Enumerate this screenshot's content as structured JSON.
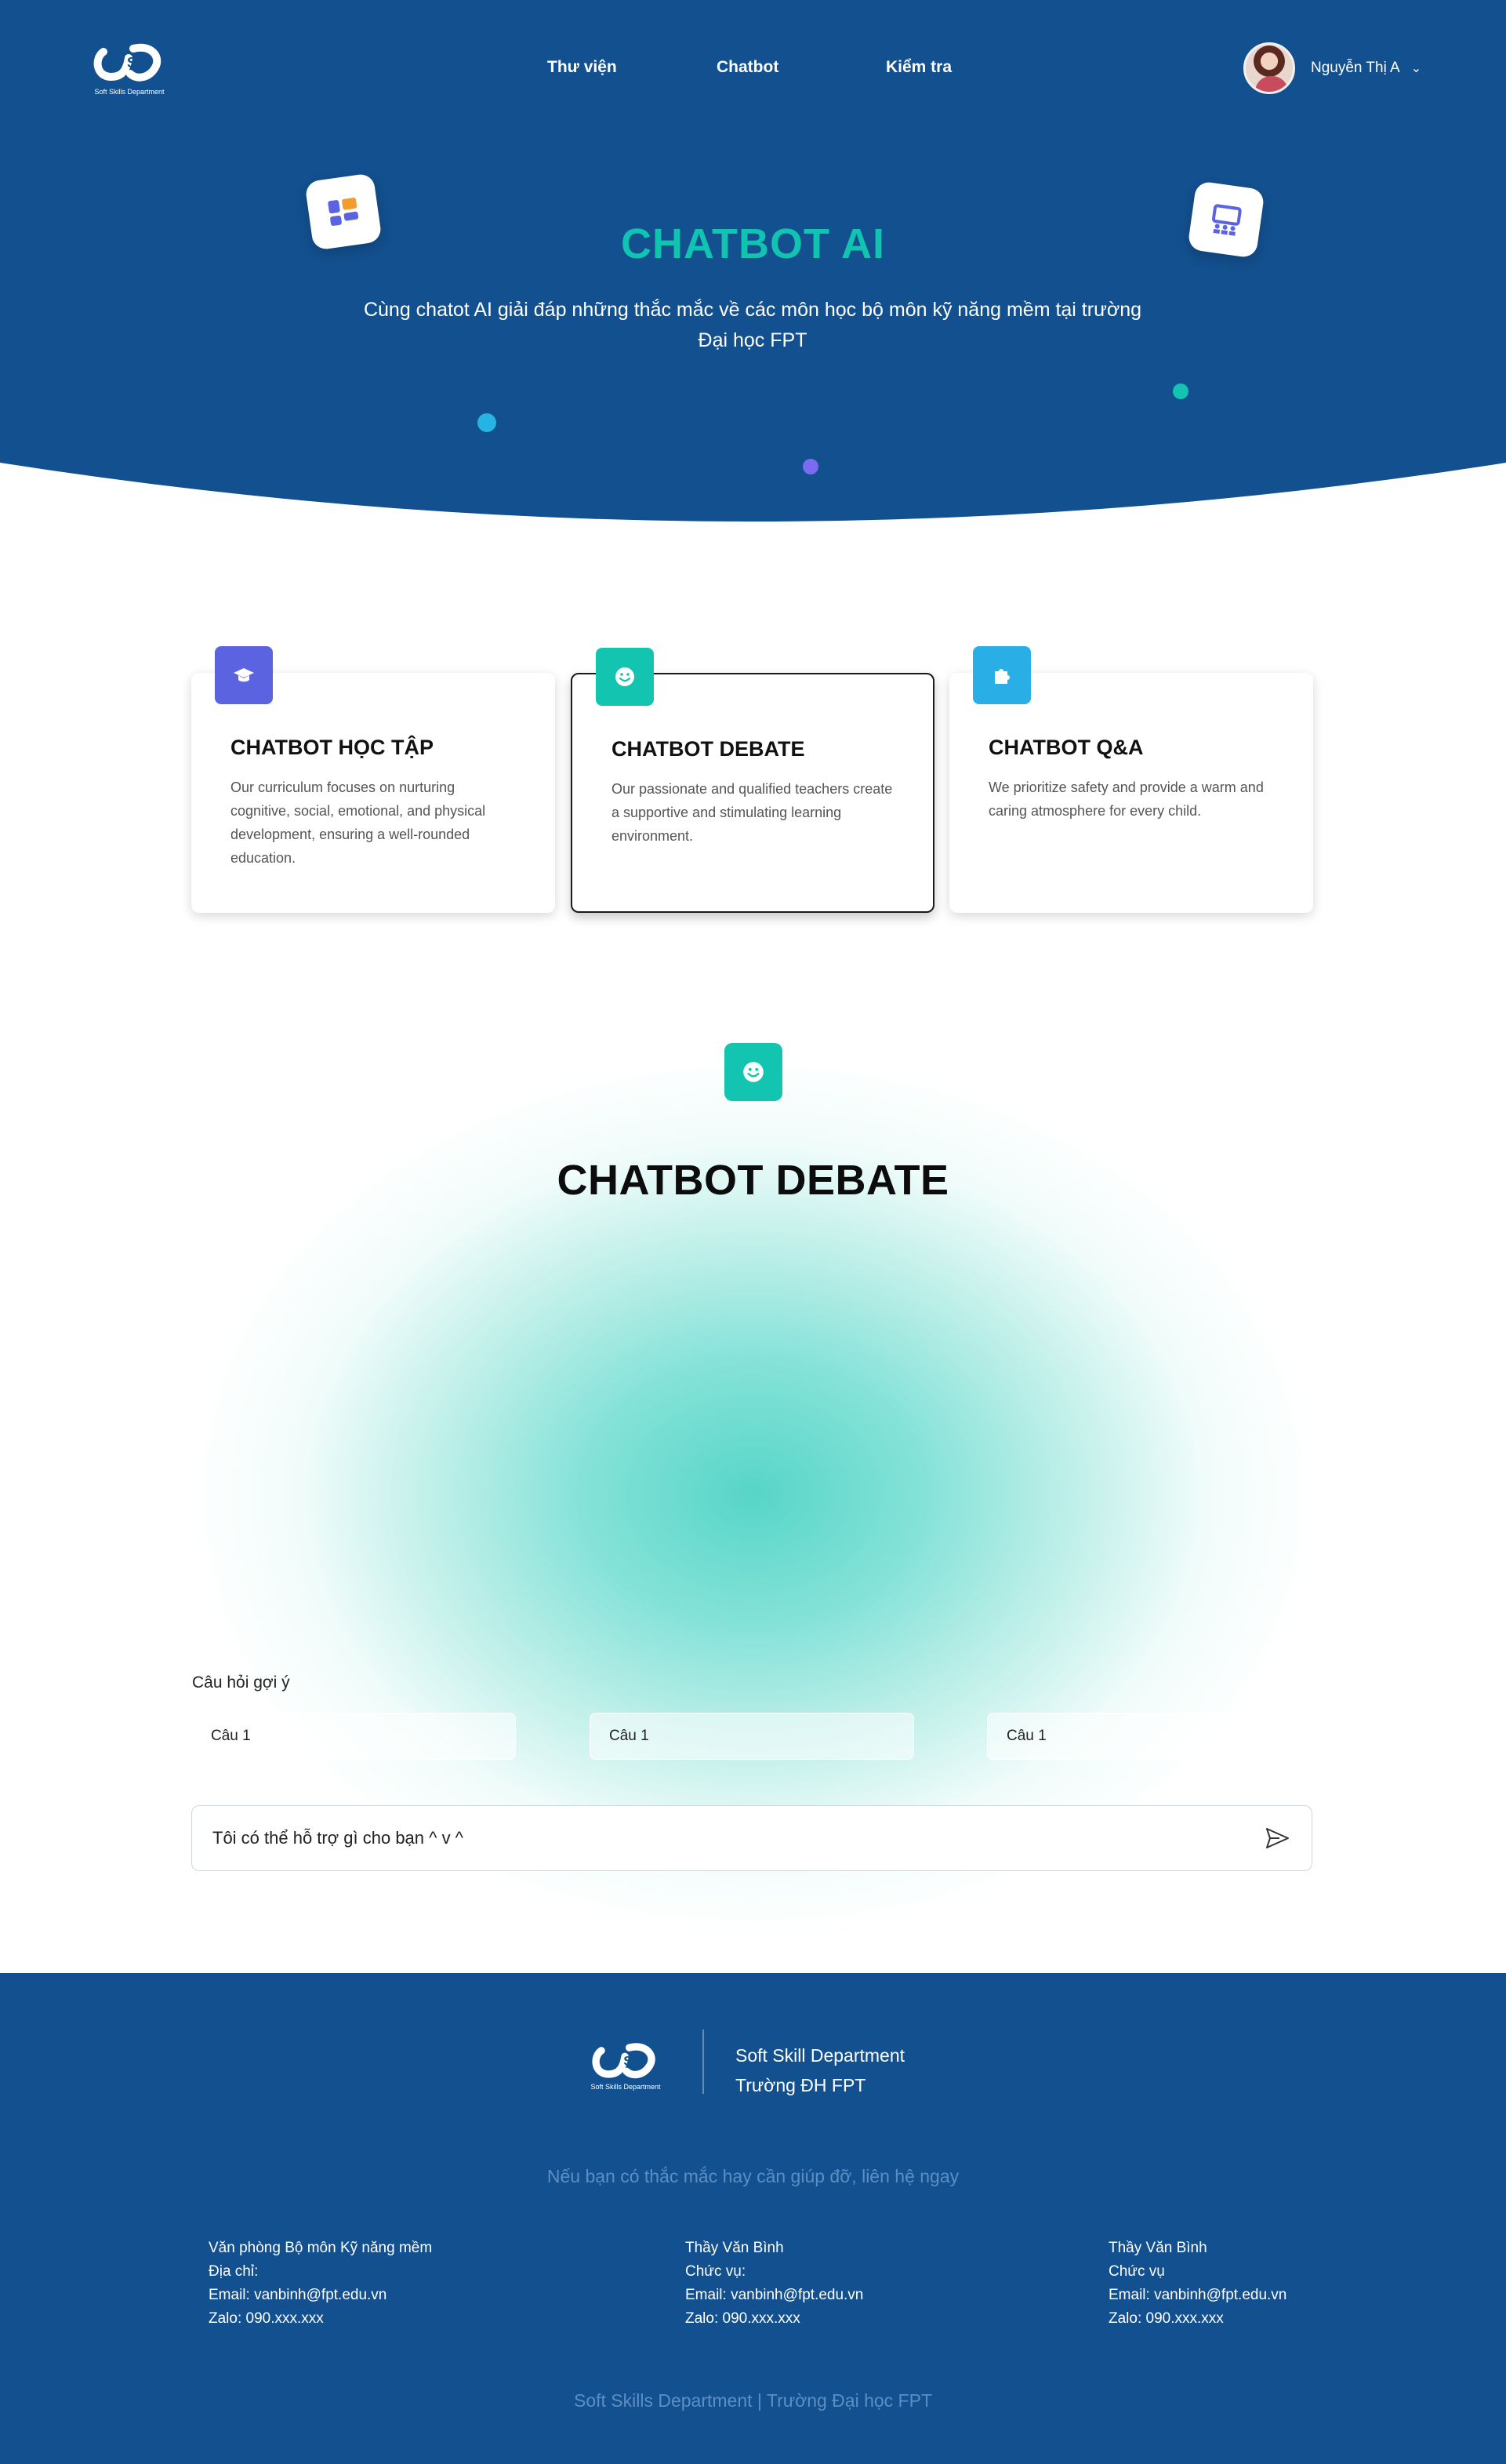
{
  "header": {
    "logo_caption": "Soft Skills Department",
    "nav": [
      "Thư viện",
      "Chatbot",
      "Kiểm tra"
    ],
    "user_name": "Nguyễn Thị A"
  },
  "hero": {
    "title": "CHATBOT AI",
    "subtitle": "Cùng chatot AI giải đáp những thắc mắc về các môn học bộ môn kỹ năng mềm tại trường Đại học FPT"
  },
  "cards": [
    {
      "title": "CHATBOT HỌC TẬP",
      "text": "Our curriculum focuses on nurturing cognitive, social, emotional, and physical development, ensuring a well-rounded education.",
      "icon": "graduation-cap-icon",
      "color": "#5b63e0"
    },
    {
      "title": "CHATBOT DEBATE",
      "text": "Our passionate and qualified teachers create a supportive and stimulating learning environment.",
      "icon": "smile-icon",
      "color": "#13c4b0"
    },
    {
      "title": "CHATBOT Q&A",
      "text": "We prioritize safety and provide a warm and caring atmosphere for every child.",
      "icon": "puzzle-icon",
      "color": "#2aaee6"
    }
  ],
  "debate": {
    "title": "CHATBOT DEBATE",
    "suggest_label": "Câu hỏi gợi ý",
    "suggestions": [
      "Câu 1",
      "Câu 1",
      "Câu 1"
    ],
    "input_value": "Tôi có thể hỗ trợ gì cho bạn ^ v ^"
  },
  "footer": {
    "logo_caption": "Soft Skills Department",
    "dept_line1": "Soft Skill Department",
    "dept_line2": "Trường ĐH FPT",
    "contact_prompt": "Nếu bạn có thắc mắc hay cần giúp đỡ, liên hệ ngay",
    "columns": [
      [
        "Văn phòng Bộ môn Kỹ năng mềm",
        "Địa chỉ:",
        "Email: vanbinh@fpt.edu.vn",
        "Zalo: 090.xxx.xxx"
      ],
      [
        "Thầy Văn Bình",
        "Chức vụ:",
        "Email: vanbinh@fpt.edu.vn",
        "Zalo: 090.xxx.xxx"
      ],
      [
        "Thầy Văn Bình",
        "Chức vụ",
        "Email: vanbinh@fpt.edu.vn",
        "Zalo: 090.xxx.xxx"
      ]
    ],
    "copyright": "Soft Skills Department | Trường Đại học FPT"
  },
  "colors": {
    "primary": "#13508f",
    "accent_teal": "#11c4b2",
    "accent_purple": "#5b63e0",
    "accent_blue": "#2aaee6"
  }
}
